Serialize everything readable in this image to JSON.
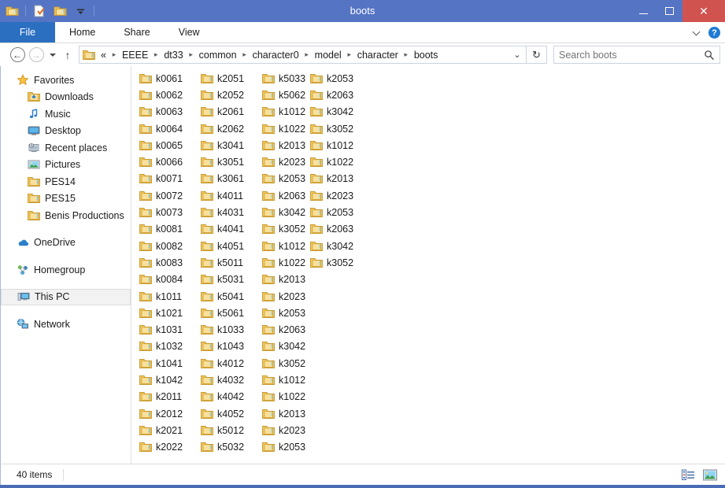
{
  "window": {
    "title": "boots",
    "minimize_label": "Minimize",
    "maximize_label": "Maximize",
    "close_label": "Close"
  },
  "quick_access": {
    "items": [
      {
        "name": "folder-properties-icon",
        "label": "Properties"
      },
      {
        "name": "new-folder-icon",
        "label": "New folder"
      },
      {
        "name": "folder-icon",
        "label": "Open folder"
      },
      {
        "name": "customize-dropdown-icon",
        "label": "Customize Quick Access Toolbar"
      }
    ]
  },
  "ribbon": {
    "file_tab": "File",
    "tabs": [
      {
        "label": "Home"
      },
      {
        "label": "Share"
      },
      {
        "label": "View"
      }
    ],
    "collapse_label": "Minimize the Ribbon",
    "help_label": "?"
  },
  "addressbar": {
    "back_label": "Back",
    "forward_label": "Forward",
    "recent_label": "Recent locations",
    "up_label": "Up",
    "overflow": "«",
    "crumbs": [
      "EEEE",
      "dt33",
      "common",
      "character0",
      "model",
      "character",
      "boots"
    ],
    "separator": "▸",
    "dropdown_label": "Previous locations",
    "refresh_label": "Refresh"
  },
  "search": {
    "placeholder": "Search boots",
    "value": "",
    "icon": "search-icon"
  },
  "sidebar": {
    "groups": [
      {
        "header": {
          "label": "Favorites",
          "icon": "star-icon"
        },
        "items": [
          {
            "label": "Downloads",
            "icon": "downloads-folder-icon"
          },
          {
            "label": "Music",
            "icon": "music-note-icon"
          },
          {
            "label": "Desktop",
            "icon": "desktop-monitor-icon"
          },
          {
            "label": "Recent places",
            "icon": "recent-places-icon"
          },
          {
            "label": "Pictures",
            "icon": "pictures-icon"
          },
          {
            "label": "PES14",
            "icon": "folder-icon"
          },
          {
            "label": "PES15",
            "icon": "folder-icon"
          },
          {
            "label": "Benis Productions",
            "icon": "folder-icon"
          }
        ]
      },
      {
        "header": {
          "label": "OneDrive",
          "icon": "onedrive-cloud-icon"
        },
        "items": []
      },
      {
        "header": {
          "label": "Homegroup",
          "icon": "homegroup-icon"
        },
        "items": []
      },
      {
        "header": {
          "label": "This PC",
          "icon": "this-pc-icon",
          "selected": true
        },
        "items": []
      },
      {
        "header": {
          "label": "Network",
          "icon": "network-icon"
        },
        "items": []
      }
    ]
  },
  "files": {
    "columns": [
      {
        "items": [
          "k0061",
          "k0062",
          "k0063",
          "k0064",
          "k0065",
          "k0066",
          "k0071",
          "k0072",
          "k0073",
          "k0081",
          "k0082",
          "k0083",
          "k0084",
          "k1011",
          "k1021",
          "k1031",
          "k1032",
          "k1041",
          "k1042",
          "k2011",
          "k2012",
          "k2021",
          "k2022"
        ]
      },
      {
        "items": [
          "k2051",
          "k2052",
          "k2061",
          "k2062",
          "k3041",
          "k3051",
          "k3061",
          "k4011",
          "k4031",
          "k4041",
          "k4051",
          "k5011",
          "k5031",
          "k5041",
          "k5061",
          "k1033",
          "k1043",
          "k4012",
          "k4032",
          "k4042",
          "k4052",
          "k5012",
          "k5032"
        ]
      },
      {
        "items": [
          "k5033",
          "k5062",
          "k1012",
          "k1022",
          "k2013",
          "k2023",
          "k2053",
          "k2063",
          "k3042",
          "k3052",
          "k1012",
          "k1022",
          "k2013",
          "k2023",
          "k2053",
          "k2063",
          "k3042",
          "k3052",
          "k1012",
          "k1022",
          "k2013",
          "k2023",
          "k2053"
        ]
      },
      {
        "items": [
          "k2053",
          "k2063",
          "k3042",
          "k3052",
          "k1012",
          "k1022",
          "k2013",
          "k2023",
          "k2053",
          "k2063",
          "k3042",
          "k3052"
        ]
      }
    ]
  },
  "statusbar": {
    "item_count": "40 items",
    "view_details_label": "Details view",
    "view_large_icons_label": "Large icons view"
  },
  "colors": {
    "titlebar": "#5574c4",
    "file_tab": "#2b6fc1",
    "close_button": "#d0534f",
    "folder_body": "#f5d07a",
    "folder_edge": "#d9a73c",
    "selection": "#f2f2f2"
  }
}
